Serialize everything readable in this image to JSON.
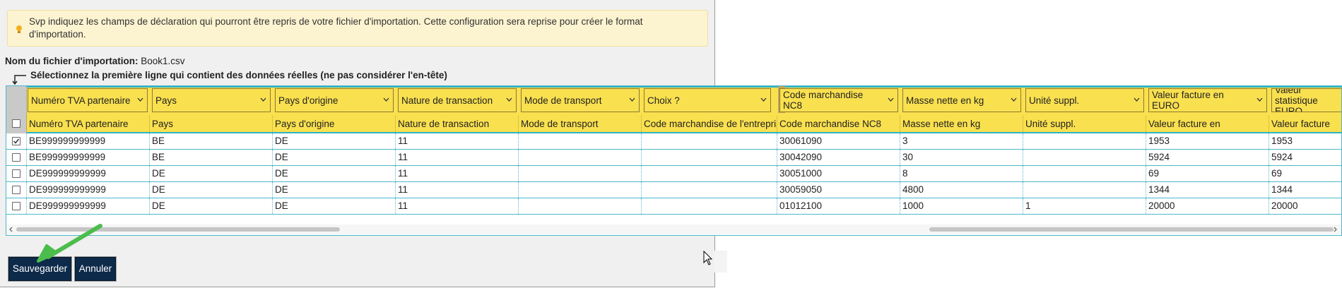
{
  "info": {
    "text": "Svp indiquez les champs de déclaration qui pourront être repris de votre fichier d'importation. Cette configuration sera reprise pour créer le format d'importation."
  },
  "file": {
    "label": "Nom du fichier d'importation:",
    "value": "Book1.csv"
  },
  "instruction": "Sélectionnez la première ligne qui contient des données réelles (ne pas considérer l'en-tête)",
  "mapping_dropdowns": [
    "Numéro TVA partenaire",
    "Pays",
    "Pays d'origine",
    "Nature de transaction",
    "Mode de transport",
    "Choix ?",
    "Code marchandise NC8",
    "Masse nette en kg",
    "Unité suppl.",
    "Valeur facture en EURO",
    "Valeur statistique EURO"
  ],
  "file_header_row": [
    "Numéro TVA partenaire",
    "Pays",
    "Pays d'origine",
    "Nature de transaction",
    "Mode de transport",
    "Code marchandise de l'entreprise",
    "Code marchandise NC8",
    "Masse nette en kg",
    "Unité suppl.",
    "Valeur facture en",
    "Valeur facture"
  ],
  "rows": [
    {
      "checked": true,
      "cells": [
        "BE999999999999",
        "BE",
        "DE",
        "11",
        "",
        "",
        "30061090",
        "3",
        "",
        "1953",
        "1953"
      ]
    },
    {
      "checked": false,
      "cells": [
        "BE999999999999",
        "BE",
        "DE",
        "11",
        "",
        "",
        "30042090",
        "30",
        "",
        "5924",
        "5924"
      ]
    },
    {
      "checked": false,
      "cells": [
        "DE999999999999",
        "DE",
        "DE",
        "11",
        "",
        "",
        "30051000",
        "8",
        "",
        "69",
        "69"
      ]
    },
    {
      "checked": false,
      "cells": [
        "DE999999999999",
        "DE",
        "DE",
        "11",
        "",
        "",
        "30059050",
        "4800",
        "",
        "1344",
        "1344"
      ]
    },
    {
      "checked": false,
      "cells": [
        "DE999999999999",
        "DE",
        "DE",
        "11",
        "",
        "",
        "01012100",
        "1000",
        "1",
        "20000",
        "20000"
      ]
    }
  ],
  "buttons": {
    "save": "Sauvegarder",
    "cancel": "Annuler"
  },
  "colors": {
    "header_yellow": "#f9e04f",
    "accent_teal": "#2cb3c7",
    "button_navy": "#0d2a4a",
    "annotation_green": "#4cbd4c"
  },
  "icons": [
    "lightbulb-icon",
    "corner-arrow-icon",
    "chevron-down-icon",
    "checkbox-icon",
    "scroll-left-icon",
    "scroll-right-icon",
    "mouse-cursor-icon",
    "annotation-arrow"
  ]
}
